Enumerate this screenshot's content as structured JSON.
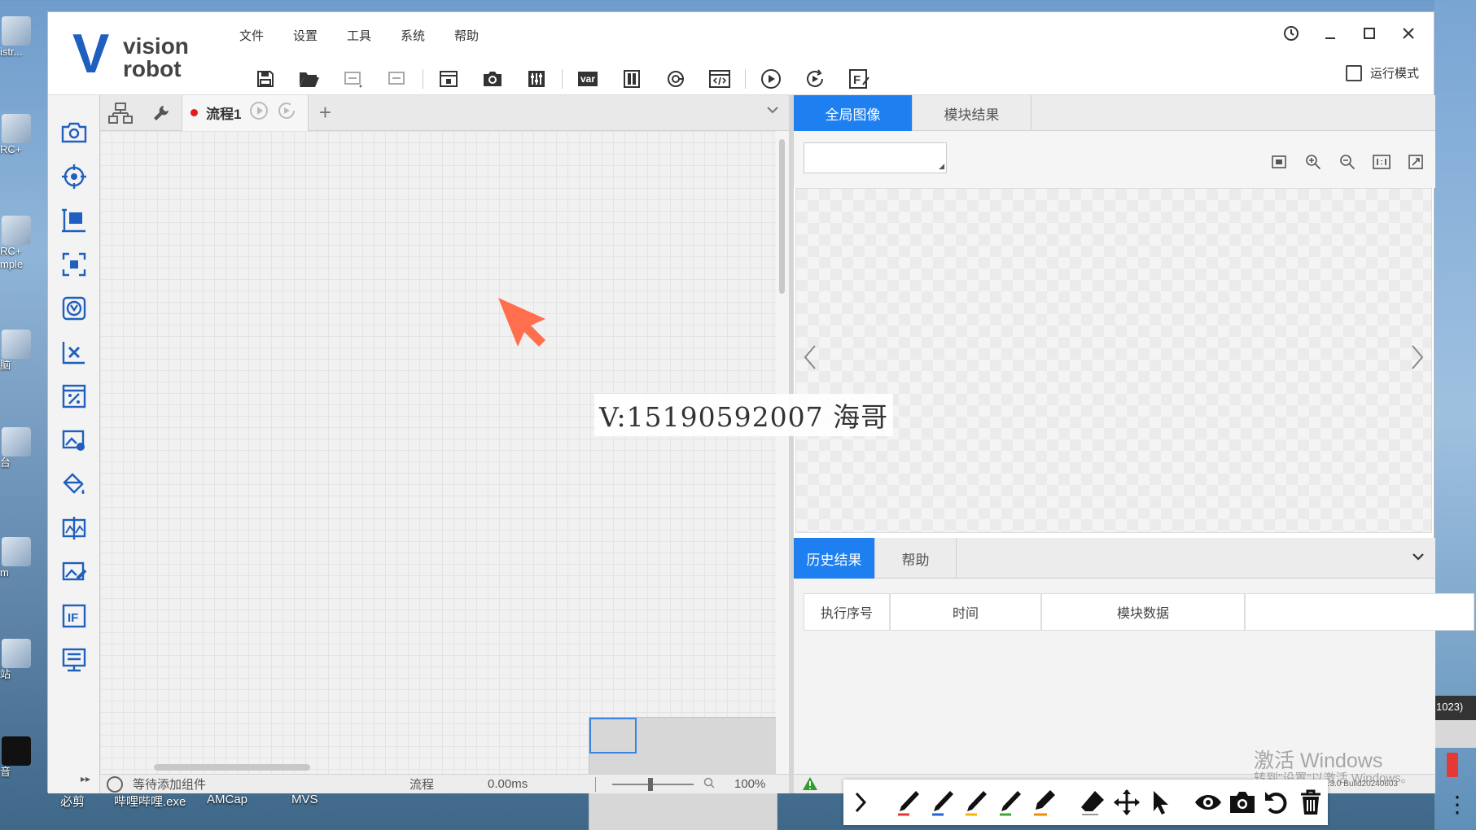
{
  "desktop": {
    "left_labels": [
      "istr...",
      "RC+",
      "RC+",
      "mple",
      "脑",
      "台",
      "m",
      "站",
      "音"
    ],
    "tray_text": "1023)",
    "taskbar_labels": [
      "必剪",
      "哔哩哔哩.exe",
      "AMCap",
      "MVS"
    ]
  },
  "window": {
    "logo": {
      "mark": "V",
      "line1": "vision",
      "line2": "robot"
    },
    "menu": [
      "文件",
      "设置",
      "工具",
      "系统",
      "帮助"
    ],
    "run_mode_label": "运行模式",
    "toolbar_icons": [
      "save-icon",
      "open-folder-icon",
      "undo-icon",
      "redo-icon",
      "lock-icon",
      "camera-icon",
      "sliders-icon",
      "variable-icon",
      "device-icon",
      "communication-icon",
      "code-icon",
      "run-once-icon",
      "run-loop-icon",
      "script-icon"
    ],
    "toolbar_var_text": "var"
  },
  "flow": {
    "tab_label": "流程1",
    "add_symbol": "+",
    "status": {
      "waiting": "等待添加组件",
      "flow_label": "流程",
      "time": "0.00ms",
      "zoom": "100%"
    }
  },
  "overlay": {
    "watermark": "V:15190592007 海哥"
  },
  "image_panel": {
    "tabs": [
      "全局图像",
      "模块结果"
    ],
    "active_tab": 0
  },
  "result_panel": {
    "tabs": [
      "历史结果",
      "帮助"
    ],
    "active_tab": 0,
    "columns": [
      "执行序号",
      "时间",
      "模块数据",
      ""
    ],
    "build_text": "V4.3.0 Build20240603"
  },
  "system": {
    "activate_title": "激活 Windows",
    "activate_sub": "转到\"设置\"以激活 Windows。"
  },
  "colors": {
    "accent": "#1e7ff0",
    "logo_blue": "#1f5fbf",
    "cursor_orange": "#ff6f4d",
    "record_red": "#e21b1b"
  }
}
